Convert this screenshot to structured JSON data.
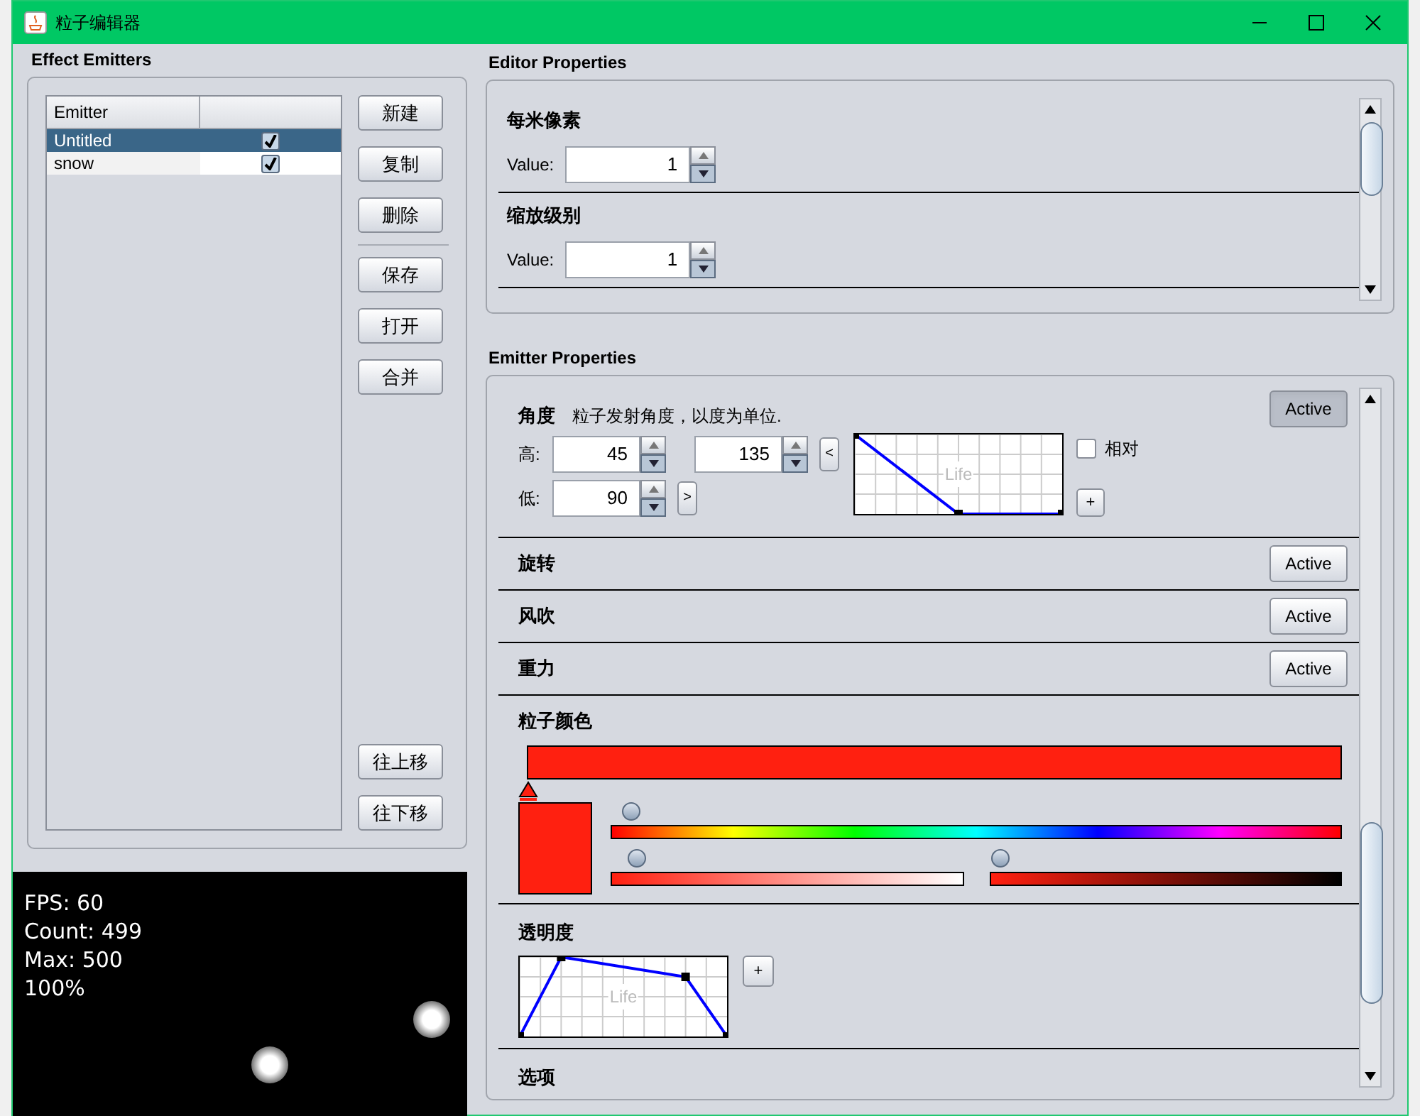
{
  "window": {
    "title": "粒子编辑器"
  },
  "effect_emitters": {
    "title": "Effect Emitters",
    "columns": [
      "Emitter"
    ],
    "rows": [
      {
        "name": "Untitled",
        "enabled": true,
        "selected": true
      },
      {
        "name": "snow",
        "enabled": true,
        "selected": false
      }
    ],
    "buttons": [
      "新建",
      "复制",
      "删除"
    ],
    "file_buttons": [
      "保存",
      "打开",
      "合并"
    ],
    "move_buttons": [
      "往上移",
      "往下移"
    ]
  },
  "preview": {
    "lines": [
      "FPS: 60",
      "Count: 499",
      "Max: 500",
      "100%"
    ]
  },
  "editor_properties": {
    "title": "Editor Properties",
    "items": [
      {
        "title": "每米像素",
        "value_label": "Value:",
        "value": "1"
      },
      {
        "title": "缩放级别",
        "value_label": "Value:",
        "value": "1"
      }
    ]
  },
  "emitter_properties": {
    "title": "Emitter Properties",
    "sections": [
      {
        "kind": "range",
        "title": "角度",
        "description": "粒子发射角度，以度为单位.",
        "active_label": "Active",
        "on": true,
        "high_label": "高:",
        "high_values": [
          "45",
          "135"
        ],
        "low_label": "低:",
        "low_value": "90",
        "collapse": "<",
        "expand": ">",
        "relative_label": "相对",
        "relative_checked": false,
        "add": "+",
        "chart_label": "Life"
      },
      {
        "kind": "toggle",
        "title": "旋转",
        "active_label": "Active",
        "on": false
      },
      {
        "kind": "toggle",
        "title": "风吹",
        "active_label": "Active",
        "on": false
      },
      {
        "kind": "toggle",
        "title": "重力",
        "active_label": "Active",
        "on": false
      },
      {
        "kind": "color",
        "title": "粒子颜色",
        "color": "#ff2010"
      },
      {
        "kind": "curve",
        "title": "透明度",
        "add": "+",
        "chart_label": "Life"
      },
      {
        "kind": "header",
        "title": "选项"
      }
    ]
  }
}
